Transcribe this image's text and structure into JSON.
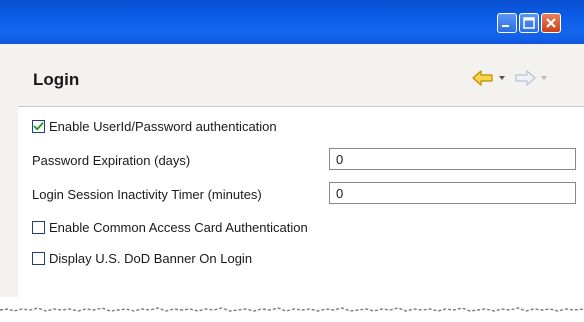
{
  "window": {
    "controls": {
      "minimize_icon": "minimize-icon",
      "maximize_icon": "maximize-icon",
      "close_icon": "close-icon"
    },
    "colors": {
      "titlebar": "#0b5be6",
      "close": "#c84117",
      "panel": "#f3f2ef"
    }
  },
  "header": {
    "title": "Login",
    "nav": {
      "back_icon": "arrow-left-icon",
      "forward_icon": "arrow-right-icon",
      "back_color": "#e8b200",
      "forward_color": "#b9c3d6"
    }
  },
  "form": {
    "enable_userid_password": {
      "label": "Enable UserId/Password authentication",
      "checked": true
    },
    "password_expiration": {
      "label": "Password Expiration (days)",
      "value": "0"
    },
    "session_timer": {
      "label": "Login Session Inactivity Timer (minutes)",
      "value": "0"
    },
    "enable_cac": {
      "label": "Enable Common Access Card Authentication",
      "checked": false
    },
    "dod_banner": {
      "label": "Display U.S. DoD Banner On Login",
      "checked": false
    }
  }
}
